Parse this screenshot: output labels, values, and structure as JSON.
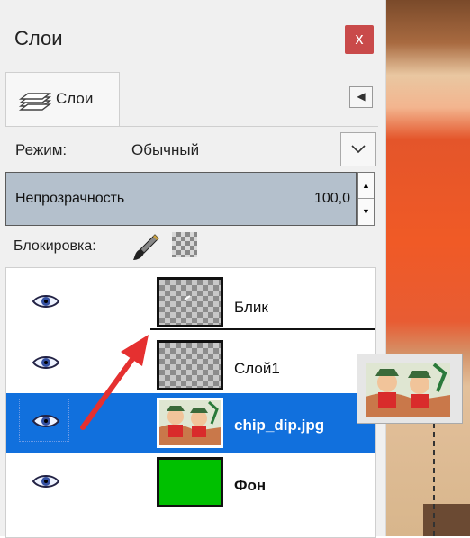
{
  "panel": {
    "title": "Слои",
    "close_label": "x"
  },
  "tab": {
    "label": "Слои",
    "icon": "layers-stack-icon"
  },
  "mode": {
    "label": "Режим:",
    "value": "Обычный"
  },
  "opacity": {
    "label": "Непрозрачность",
    "value": "100,0"
  },
  "lock": {
    "label": "Блокировка:"
  },
  "layers": [
    {
      "name": "Блик",
      "visible": true,
      "selected": false,
      "thumbnail": "transparent"
    },
    {
      "name": "Слой1",
      "visible": true,
      "selected": false,
      "thumbnail": "transparent"
    },
    {
      "name": "chip_dip.jpg",
      "visible": true,
      "selected": true,
      "thumbnail": "cartoon-image"
    },
    {
      "name": "Фон",
      "visible": true,
      "selected": false,
      "thumbnail": "green-fill"
    }
  ],
  "colors": {
    "selection": "#1170dd",
    "opacity_bar": "#b4c0cc",
    "close": "#c94a4a",
    "background_layer": "#00c000",
    "arrow": "#e53030"
  }
}
